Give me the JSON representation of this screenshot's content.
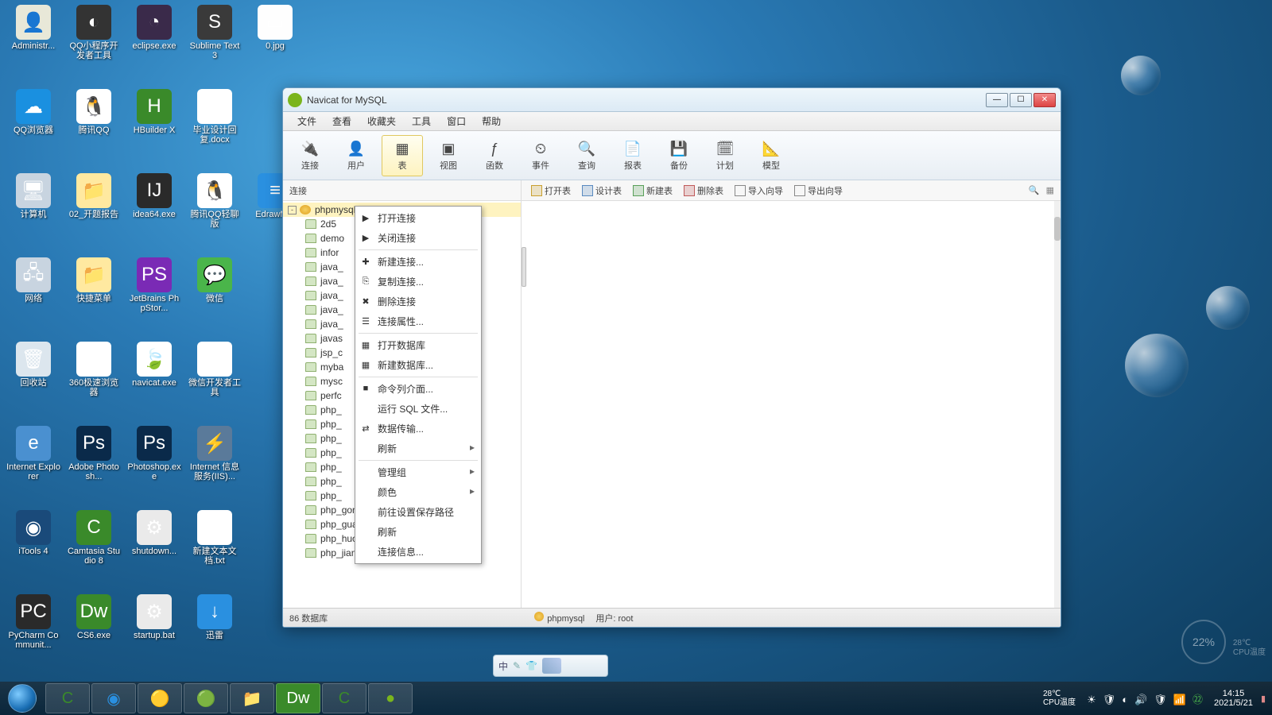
{
  "desktop_icons": [
    {
      "row": 0,
      "col": 0,
      "label": "Administr...",
      "bg": "#e8e8d8",
      "glyph": "👤"
    },
    {
      "row": 0,
      "col": 1,
      "label": "QQ小程序开发者工具",
      "bg": "#333",
      "glyph": "◐"
    },
    {
      "row": 0,
      "col": 2,
      "label": "eclipse.exe",
      "bg": "#3a2a4a",
      "glyph": "◔"
    },
    {
      "row": 0,
      "col": 3,
      "label": "Sublime Text 3",
      "bg": "#3a3a3a",
      "glyph": "S"
    },
    {
      "row": 0,
      "col": 4,
      "label": "0.jpg",
      "bg": "#fefefe",
      "glyph": "▭"
    },
    {
      "row": 1,
      "col": 0,
      "label": "QQ浏览器",
      "bg": "#1a90e0",
      "glyph": "☁"
    },
    {
      "row": 1,
      "col": 1,
      "label": "腾讯QQ",
      "bg": "#fff",
      "glyph": "🐧"
    },
    {
      "row": 1,
      "col": 2,
      "label": "HBuilder X",
      "bg": "#3a8a2a",
      "glyph": "H"
    },
    {
      "row": 1,
      "col": 3,
      "label": "毕业设计回复.docx",
      "bg": "#fff",
      "glyph": "W"
    },
    {
      "row": 2,
      "col": 0,
      "label": "计算机",
      "bg": "#c8d4e0",
      "glyph": "🖥"
    },
    {
      "row": 2,
      "col": 1,
      "label": "02_开题报告",
      "bg": "#ffe9a0",
      "glyph": "📁"
    },
    {
      "row": 2,
      "col": 2,
      "label": "idea64.exe",
      "bg": "#2a2a2a",
      "glyph": "IJ"
    },
    {
      "row": 2,
      "col": 3,
      "label": "腾讯QQ轻聊版",
      "bg": "#fff",
      "glyph": "🐧"
    },
    {
      "row": 2,
      "col": 4,
      "label": "EdrawM...",
      "bg": "#2a90e0",
      "glyph": "≡"
    },
    {
      "row": 3,
      "col": 0,
      "label": "网络",
      "bg": "#c8d4e0",
      "glyph": "🖧"
    },
    {
      "row": 3,
      "col": 1,
      "label": "快捷菜单",
      "bg": "#ffe9a0",
      "glyph": "📁"
    },
    {
      "row": 3,
      "col": 2,
      "label": "JetBrains PhpStor...",
      "bg": "#7a2ab5",
      "glyph": "PS"
    },
    {
      "row": 3,
      "col": 3,
      "label": "微信",
      "bg": "#4ab54a",
      "glyph": "💬"
    },
    {
      "row": 4,
      "col": 0,
      "label": "回收站",
      "bg": "#dce6ee",
      "glyph": "🗑"
    },
    {
      "row": 4,
      "col": 1,
      "label": "360极速浏览器",
      "bg": "#fff",
      "glyph": "◉"
    },
    {
      "row": 4,
      "col": 2,
      "label": "navicat.exe",
      "bg": "#fff",
      "glyph": "🍃"
    },
    {
      "row": 4,
      "col": 3,
      "label": "微信开发者工具",
      "bg": "#fff",
      "glyph": "⚙"
    },
    {
      "row": 5,
      "col": 0,
      "label": "Internet Explorer",
      "bg": "#4a90d0",
      "glyph": "e"
    },
    {
      "row": 5,
      "col": 1,
      "label": "Adobe Photosh...",
      "bg": "#0a2a4a",
      "glyph": "Ps"
    },
    {
      "row": 5,
      "col": 2,
      "label": "Photoshop.exe",
      "bg": "#0a2a4a",
      "glyph": "Ps"
    },
    {
      "row": 5,
      "col": 3,
      "label": "Internet 信息服务(IIS)...",
      "bg": "#5a7a9a",
      "glyph": "⚡"
    },
    {
      "row": 6,
      "col": 0,
      "label": "iTools 4",
      "bg": "#1a4a7a",
      "glyph": "◉"
    },
    {
      "row": 6,
      "col": 1,
      "label": "Camtasia Studio 8",
      "bg": "#3a8a2a",
      "glyph": "C"
    },
    {
      "row": 6,
      "col": 2,
      "label": "shutdown...",
      "bg": "#eaeaea",
      "glyph": "⚙"
    },
    {
      "row": 6,
      "col": 3,
      "label": "新建文本文档.txt",
      "bg": "#fff",
      "glyph": "≡"
    },
    {
      "row": 7,
      "col": 0,
      "label": "PyCharm Communit...",
      "bg": "#2a2a2a",
      "glyph": "PC"
    },
    {
      "row": 7,
      "col": 1,
      "label": "CS6.exe",
      "bg": "#3a8a2a",
      "glyph": "Dw"
    },
    {
      "row": 7,
      "col": 2,
      "label": "startup.bat",
      "bg": "#eaeaea",
      "glyph": "⚙"
    },
    {
      "row": 7,
      "col": 3,
      "label": "迅雷",
      "bg": "#2a90e0",
      "glyph": "↓"
    }
  ],
  "window": {
    "title": "Navicat for MySQL",
    "menu": [
      "文件",
      "查看",
      "收藏夹",
      "工具",
      "窗口",
      "帮助"
    ],
    "tools": [
      {
        "label": "连接",
        "glyph": "🔌"
      },
      {
        "label": "用户",
        "glyph": "👤"
      },
      {
        "label": "表",
        "glyph": "▦",
        "active": true
      },
      {
        "label": "视图",
        "glyph": "▣"
      },
      {
        "label": "函数",
        "glyph": "ƒ"
      },
      {
        "label": "事件",
        "glyph": "⏲"
      },
      {
        "label": "查询",
        "glyph": "🔍"
      },
      {
        "label": "报表",
        "glyph": "📄"
      },
      {
        "label": "备份",
        "glyph": "💾"
      },
      {
        "label": "计划",
        "glyph": "🗓"
      },
      {
        "label": "模型",
        "glyph": "📐"
      }
    ],
    "subbar_label": "连接",
    "subbar_actions": [
      {
        "label": "打开表",
        "color": "#c9a030"
      },
      {
        "label": "设计表",
        "color": "#5a8ac0"
      },
      {
        "label": "新建表",
        "color": "#5aa05a"
      },
      {
        "label": "删除表",
        "color": "#c05a5a"
      },
      {
        "label": "导入向导",
        "color": "#888"
      },
      {
        "label": "导出向导",
        "color": "#888"
      }
    ],
    "connection": "phpmysql",
    "databases": [
      "2d5",
      "demo",
      "infor",
      "java_",
      "java_",
      "java_",
      "java_",
      "java_",
      "javas",
      "jsp_c",
      "myba",
      "mysc",
      "perfc",
      "php_",
      "php_",
      "php_",
      "php_",
      "php_",
      "php_",
      "php_",
      "php_gongxiang",
      "php_guahao",
      "php_huoche",
      "php_jianshenfang"
    ],
    "status_left": "86 数据库",
    "status_conn": "phpmysql",
    "status_user": "用户: root"
  },
  "context_menu": [
    {
      "label": "打开连接",
      "icon": "▶",
      "sep": false
    },
    {
      "label": "关闭连接",
      "icon": "▶",
      "sep": true
    },
    {
      "label": "新建连接...",
      "icon": "✚",
      "sep": false
    },
    {
      "label": "复制连接...",
      "icon": "⎘",
      "sep": false
    },
    {
      "label": "删除连接",
      "icon": "✖",
      "sep": false
    },
    {
      "label": "连接属性...",
      "icon": "☰",
      "sep": true
    },
    {
      "label": "打开数据库",
      "icon": "▦",
      "sep": false
    },
    {
      "label": "新建数据库...",
      "icon": "▦",
      "sep": true
    },
    {
      "label": "命令列介面...",
      "icon": "■",
      "sep": false
    },
    {
      "label": "运行 SQL 文件...",
      "icon": "",
      "sep": false
    },
    {
      "label": "数据传输...",
      "icon": "⇄",
      "sep": false
    },
    {
      "label": "刷新",
      "icon": "",
      "arrow": true,
      "sep": true
    },
    {
      "label": "管理组",
      "icon": "",
      "arrow": true,
      "sep": false
    },
    {
      "label": "颜色",
      "icon": "",
      "arrow": true,
      "sep": false
    },
    {
      "label": "前往设置保存路径",
      "icon": "",
      "sep": false
    },
    {
      "label": "刷新",
      "icon": "",
      "sep": false
    },
    {
      "label": "连接信息...",
      "icon": "",
      "sep": false
    }
  ],
  "langbar": {
    "label": "中"
  },
  "widget": {
    "percent": "22%",
    "weather": "28℃",
    "cpu": "CPU温度"
  },
  "taskbar": {
    "temp_top": "28℃",
    "temp_bottom": "CPU温度",
    "time": "14:15",
    "date": "2021/5/21"
  }
}
